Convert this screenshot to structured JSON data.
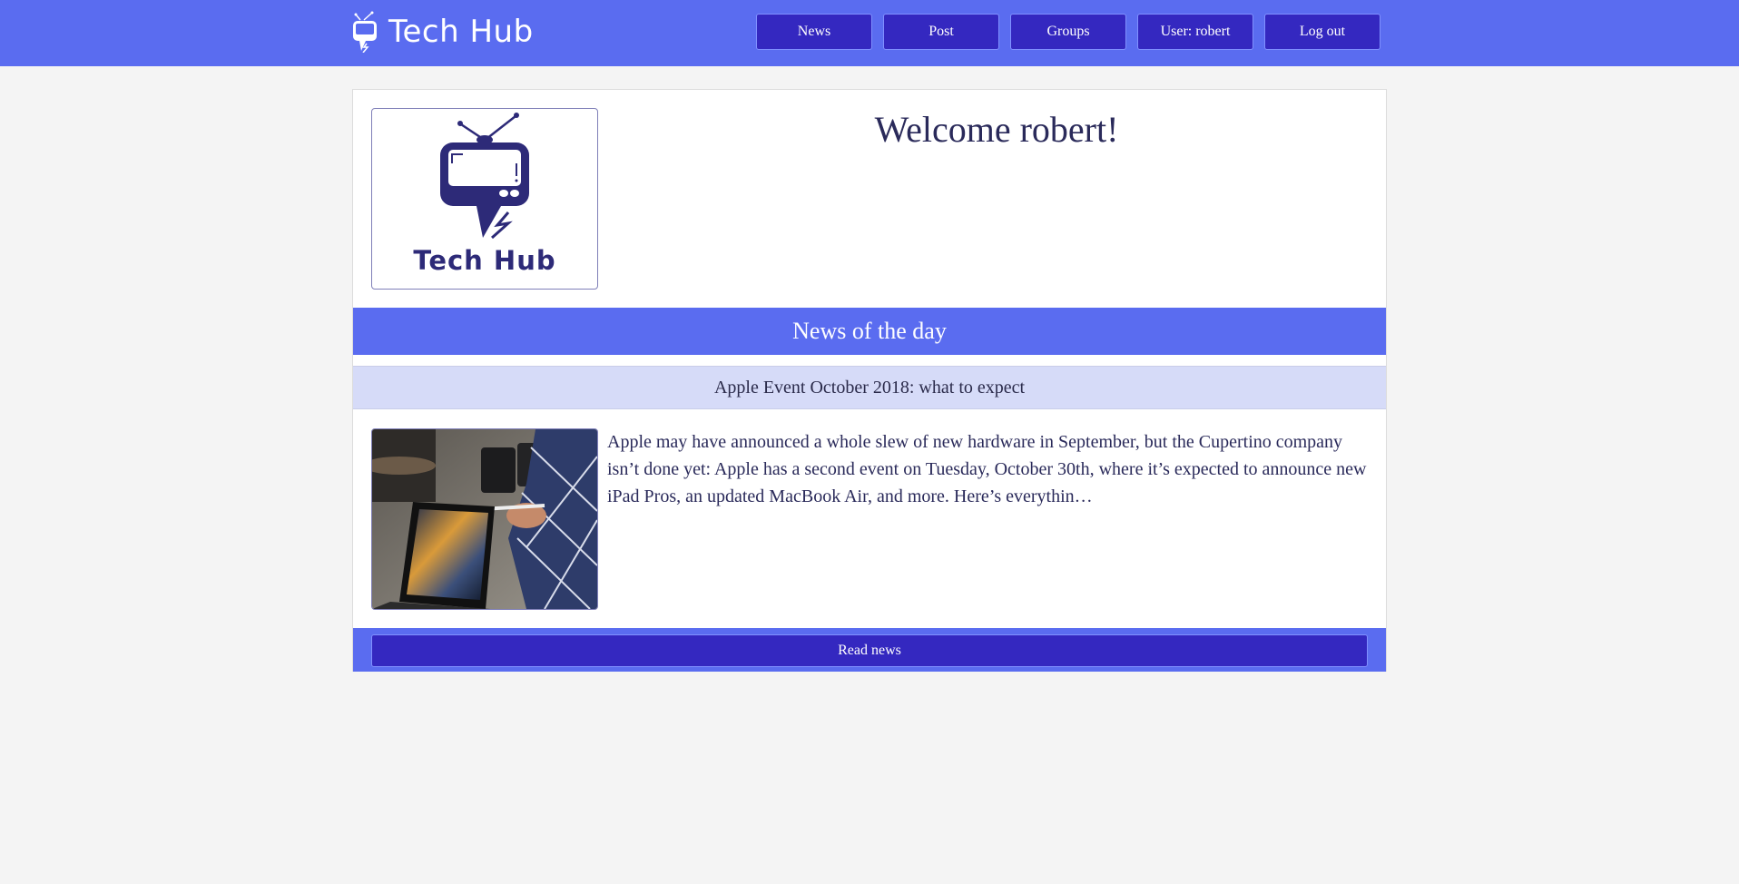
{
  "brand": {
    "name": "Tech Hub",
    "icon": "tv-speech-bubble-icon"
  },
  "nav": {
    "items": [
      {
        "label": "News"
      },
      {
        "label": "Post"
      },
      {
        "label": "Groups"
      },
      {
        "label": "User: robert"
      },
      {
        "label": "Log out"
      }
    ]
  },
  "hero": {
    "logo_caption": "Tech Hub",
    "welcome": "Welcome robert!"
  },
  "news": {
    "section_title": "News of the day",
    "article_title": "Apple Event October 2018: what to expect",
    "article_summary": "Apple may have announced a whole slew of new hardware in September, but the Cupertino company isn’t done yet: Apple has a second event on Tuesday, October 30th, where it’s expected to announce new iPad Pros, an updated MacBook Air, and more. Here’s everythin…",
    "image_alt": "ipad-pro-photo",
    "read_button": "Read news"
  },
  "colors": {
    "navbar": "#5a6cf0",
    "button": "#3428c0",
    "header_light": "#d6dbf8",
    "text_dark": "#2a2a5a",
    "logo_navy": "#2d2a78"
  }
}
